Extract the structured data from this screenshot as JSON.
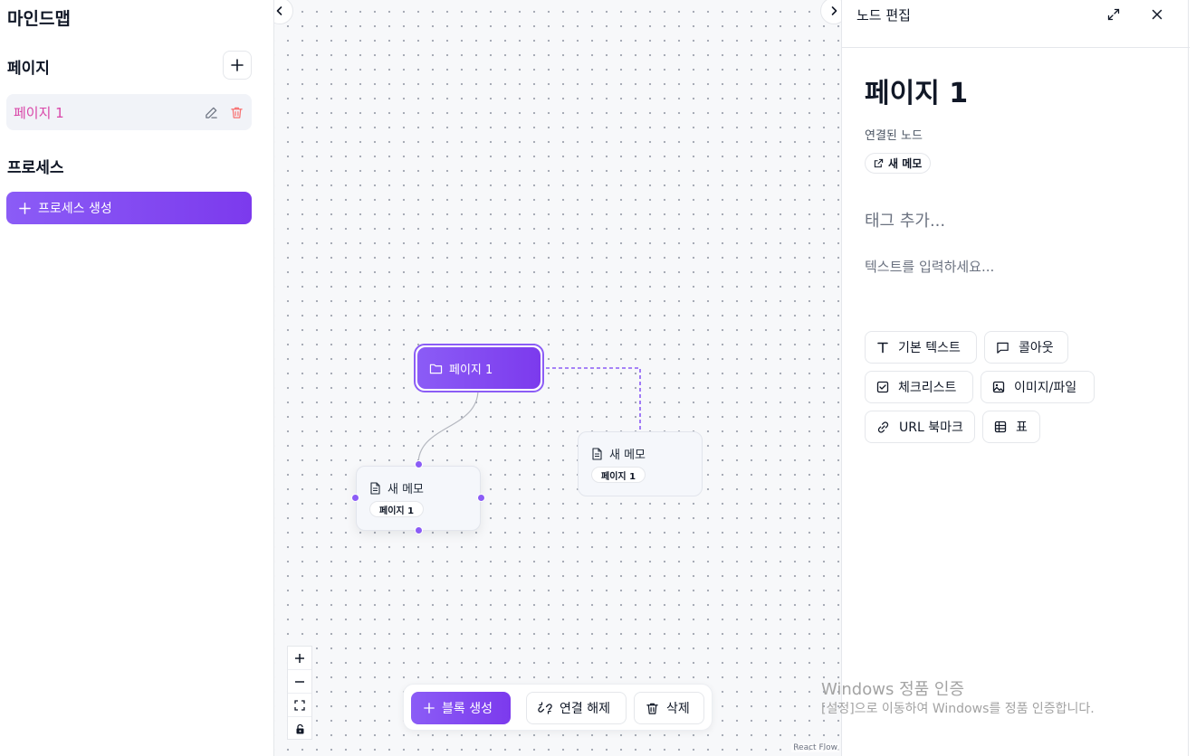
{
  "sidebar": {
    "app_title": "마인드맵",
    "pages_section": "페이지",
    "pages": [
      {
        "label": "페이지 1"
      }
    ],
    "process_section": "프로세스",
    "create_process_label": "프로세스 생성"
  },
  "canvas": {
    "main_node": {
      "label": "페이지 1"
    },
    "memo_nodes": [
      {
        "title": "새 메모",
        "tag": "페이지 1",
        "selected": true
      },
      {
        "title": "새 메모",
        "tag": "페이지 1",
        "selected": false
      }
    ],
    "toolbar": {
      "create_block": "블록 생성",
      "disconnect": "연결 해제",
      "delete": "삭제"
    },
    "attribution": "React Flow"
  },
  "panel": {
    "header_title": "노드 편집",
    "page_title": "페이지 1",
    "linked_nodes_label": "연결된 노드",
    "linked_nodes": [
      "새 메모"
    ],
    "tag_placeholder": "태그 추가...",
    "text_placeholder": "텍스트를 입력하세요...",
    "blocks": {
      "basic_text": "기본 텍스트",
      "callout": "콜아웃",
      "checklist": "체크리스트",
      "image_file": "이미지/파일",
      "url_bookmark": "URL 북마크",
      "table": "표"
    }
  },
  "watermark": {
    "line1": "Windows 정품 인증",
    "line2": "[설정]으로 이동하여 Windows를 정품 인증합니다."
  },
  "colors": {
    "accent": "#7c3aed",
    "accent_light": "#8b5cf6",
    "page_label": "#d946a8",
    "delete_icon": "#f87171"
  }
}
